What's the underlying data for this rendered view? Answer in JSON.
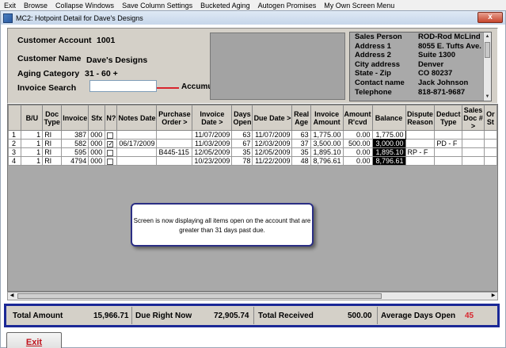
{
  "menu": [
    "Exit",
    "Browse",
    "Collapse Windows",
    "Save Column Settings",
    "Bucketed Aging",
    "Autogen Promises",
    "My Own Screen Menu"
  ],
  "window": {
    "title": "MC2: Hotpoint Detail for Dave's Designs",
    "close_label": "x"
  },
  "customer": {
    "account_label": "Customer Account",
    "account_value": "1001",
    "name_label": "Customer Name",
    "name_value": "Dave's Designs",
    "aging_label": "Aging Category",
    "aging_value": "31 - 60 +",
    "aging_note": "Accumulated Aging Range",
    "search_label": "Invoice Search",
    "search_value": ""
  },
  "info": [
    {
      "k": "Sales Person",
      "v": "ROD-Rod McLind"
    },
    {
      "k": "Address 1",
      "v": "8055 E. Tufts Ave."
    },
    {
      "k": "Address 2",
      "v": "Suite 1300"
    },
    {
      "k": "City address",
      "v": "Denver"
    },
    {
      "k": "State - Zip",
      "v": "CO  80237"
    },
    {
      "k": "Contact name",
      "v": "Jack Johnson"
    },
    {
      "k": "Telephone",
      "v": "818-871-9687"
    }
  ],
  "table": {
    "columns": [
      "",
      "B/U",
      "Doc Type",
      "Invoice",
      "Sfx",
      "N?",
      "Notes Date",
      "Purchase Order >",
      "Invoice Date >",
      "Days Open",
      "Due Date >",
      "Real Age",
      "Invoice Amount",
      "Amount R'cvd",
      "Balance",
      "Dispute Reason",
      "Deduct Type",
      "Sales Doc # >",
      "Or St"
    ],
    "rows": [
      {
        "n": "1",
        "bu": "1",
        "doc": "RI",
        "inv": "387",
        "sfx": "000",
        "noted": false,
        "notes_date": "",
        "po": "",
        "inv_date": "11/07/2009",
        "days": "63",
        "due": "11/07/2009",
        "age": "63",
        "amount": "1,775.00",
        "rcvd": "0.00",
        "balance": "1,775.00",
        "dispute": "",
        "deduct": ""
      },
      {
        "n": "2",
        "bu": "1",
        "doc": "RI",
        "inv": "582",
        "sfx": "000",
        "noted": true,
        "notes_date": "06/17/2009",
        "po": "",
        "inv_date": "11/03/2009",
        "days": "67",
        "due": "12/03/2009",
        "age": "37",
        "amount": "3,500.00",
        "rcvd": "500.00",
        "balance": "3,000.00",
        "dispute": "",
        "deduct": "PD   - F"
      },
      {
        "n": "3",
        "bu": "1",
        "doc": "RI",
        "inv": "595",
        "sfx": "000",
        "noted": false,
        "notes_date": "",
        "po": "B445-115",
        "inv_date": "12/05/2009",
        "days": "35",
        "due": "12/05/2009",
        "age": "35",
        "amount": "1,895.10",
        "rcvd": "0.00",
        "balance": "1,895.10",
        "dispute": "RP   - F",
        "deduct": ""
      },
      {
        "n": "4",
        "bu": "1",
        "doc": "RI",
        "inv": "4794",
        "sfx": "000",
        "noted": false,
        "notes_date": "",
        "po": "",
        "inv_date": "10/23/2009",
        "days": "78",
        "due": "11/22/2009",
        "age": "48",
        "amount": "8,796.61",
        "rcvd": "0.00",
        "balance": "8,796.61",
        "dispute": "",
        "deduct": ""
      }
    ]
  },
  "callout": "Screen is now displaying all items open on the account that are greater than 31 days past due.",
  "totals": {
    "total_amount_label": "Total Amount",
    "total_amount": "15,966.71",
    "due_now_label": "Due Right Now",
    "due_now": "72,905.74",
    "received_label": "Total Received",
    "received": "500.00",
    "avg_days_label": "Average Days Open",
    "avg_days": "45"
  },
  "buttons": {
    "exit": "Exit"
  },
  "colors": {
    "arrow": "#d9252d",
    "totals_border": "#1b2896",
    "avg_days": "#d9252d",
    "exit_text": "#c0121c"
  }
}
